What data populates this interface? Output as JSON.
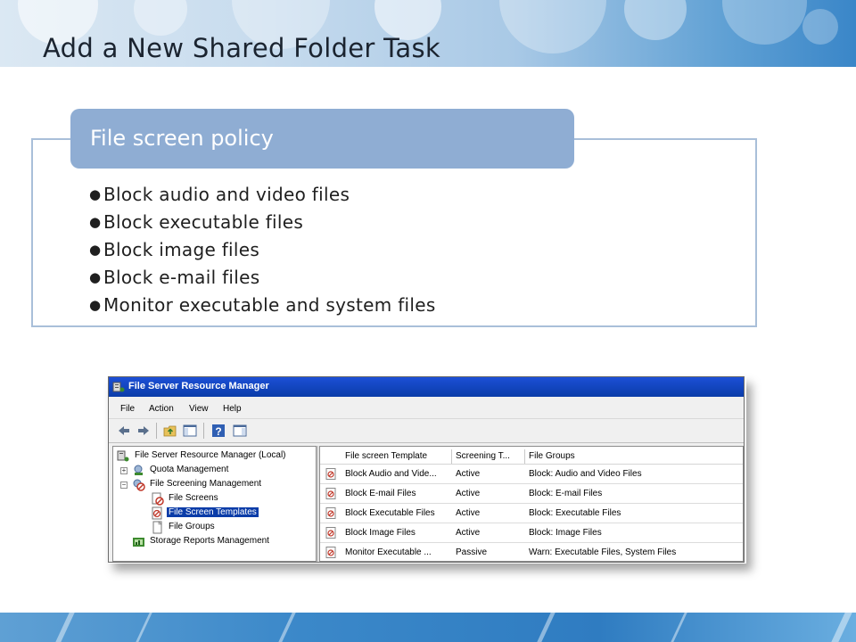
{
  "slide": {
    "title": "Add a New Shared Folder Task"
  },
  "policy": {
    "heading": "File screen policy",
    "items": [
      "Block audio and video files",
      "Block executable files",
      "Block image files",
      "Block e-mail files",
      "Monitor executable and system files"
    ]
  },
  "window": {
    "title": "File Server Resource Manager",
    "menu": [
      "File",
      "Action",
      "View",
      "Help"
    ],
    "toolbar_icons": [
      "back-arrow-icon",
      "forward-arrow-icon",
      "up-folder-icon",
      "show-hide-tree-icon",
      "help-icon",
      "show-action-pane-icon"
    ],
    "tree": {
      "root": "File Server Resource Manager (Local)",
      "quota": "Quota Management",
      "screening": "File Screening Management",
      "file_screens": "File Screens",
      "templates": "File Screen Templates",
      "file_groups": "File Groups",
      "storage_reports": "Storage Reports Management"
    },
    "list": {
      "columns": [
        "File screen Template",
        "Screening T...",
        "File Groups"
      ],
      "rows": [
        {
          "template": "Block Audio and Vide...",
          "screening": "Active",
          "groups": "Block: Audio and Video Files"
        },
        {
          "template": "Block E-mail Files",
          "screening": "Active",
          "groups": "Block: E-mail Files"
        },
        {
          "template": "Block Executable Files",
          "screening": "Active",
          "groups": "Block: Executable Files"
        },
        {
          "template": "Block Image Files",
          "screening": "Active",
          "groups": "Block: Image Files"
        },
        {
          "template": "Monitor Executable ...",
          "screening": "Passive",
          "groups": "Warn: Executable Files, System Files"
        }
      ]
    }
  },
  "colors": {
    "policy_tab": "#8fadd3",
    "policy_border": "#a9bfd9",
    "titlebar": "#0a3ca8",
    "selection": "#0a3ca8"
  }
}
